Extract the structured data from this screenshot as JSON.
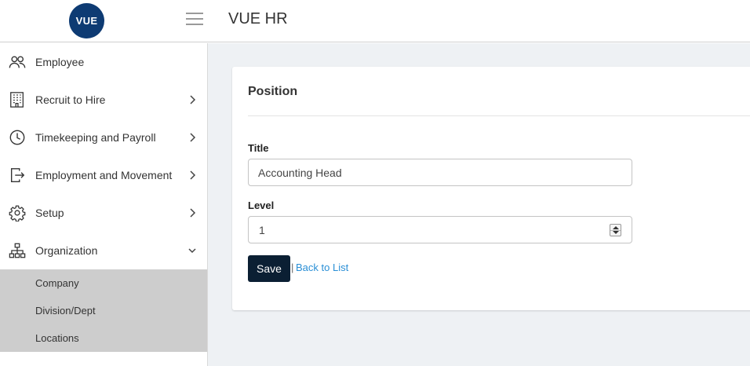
{
  "header": {
    "logo_text": "VUE",
    "logo_color": "#0e3b73",
    "app_title": "VUE HR"
  },
  "sidebar": {
    "items": [
      {
        "label": "Employee",
        "icon": "people-icon"
      },
      {
        "label": "Recruit to Hire",
        "icon": "building-icon",
        "chevron": "right"
      },
      {
        "label": "Timekeeping and Payroll",
        "icon": "clock-icon",
        "chevron": "right"
      },
      {
        "label": "Employment and Movement",
        "icon": "exit-icon",
        "chevron": "right"
      },
      {
        "label": "Setup",
        "icon": "gear-icon",
        "chevron": "right"
      },
      {
        "label": "Organization",
        "icon": "org-chart-icon",
        "chevron": "down"
      }
    ],
    "submenu": [
      {
        "label": "Company"
      },
      {
        "label": "Division/Dept"
      },
      {
        "label": "Locations"
      }
    ]
  },
  "form": {
    "title": "Position",
    "title_field_label": "Title",
    "title_field_value": "Accounting Head",
    "level_field_label": "Level",
    "level_field_value": "1",
    "save_label": "Save",
    "separator": "|",
    "back_label": "Back to List",
    "link_color": "#2a8fd6",
    "button_color": "#0b1f33"
  }
}
